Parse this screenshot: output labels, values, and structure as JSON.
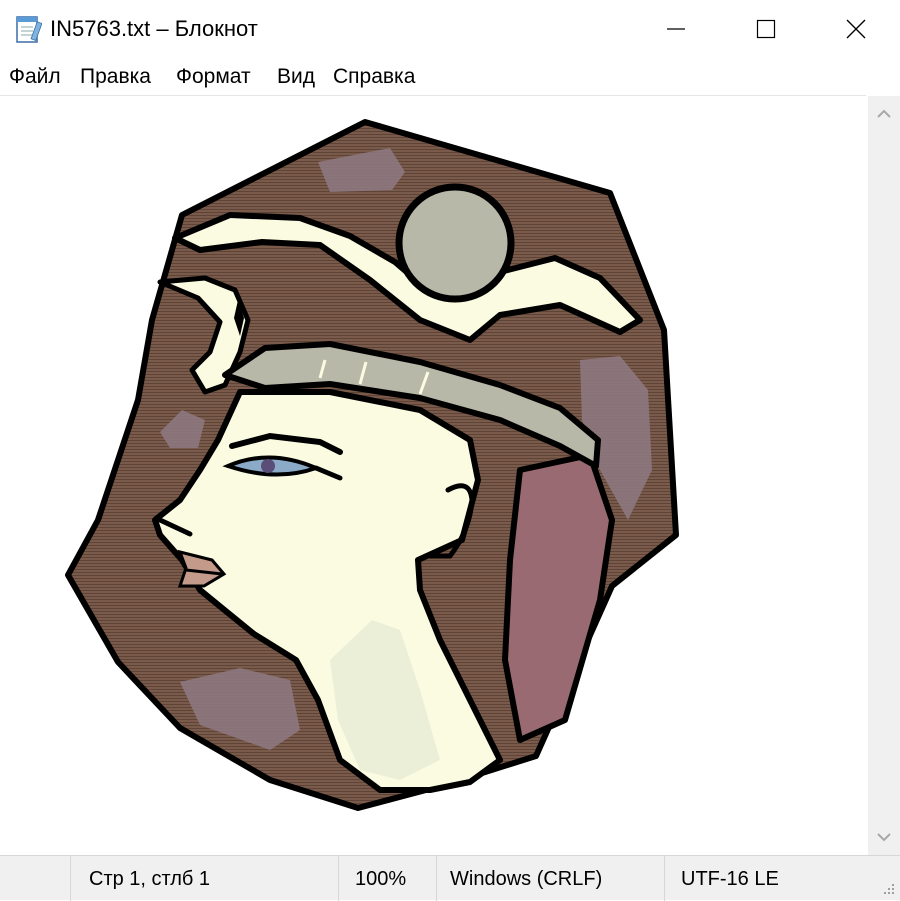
{
  "window": {
    "title": "IN5763.txt – Блокнот"
  },
  "menu": {
    "items": [
      "Файл",
      "Правка",
      "Формат",
      "Вид",
      "Справка"
    ]
  },
  "statusbar": {
    "position": "Стр 1, стлб 1",
    "zoom": "100%",
    "line_endings": "Windows (CRLF)",
    "encoding": "UTF-16 LE"
  },
  "icons": {
    "app": "notepad-icon",
    "minimize": "minimize-icon",
    "maximize": "maximize-icon",
    "close": "close-icon",
    "scroll_up": "chevron-up-icon",
    "scroll_down": "chevron-down-icon",
    "grip": "resize-grip-icon"
  },
  "colors": {
    "hair_brown": "#7a5a4a",
    "skin": "#fbfbe2",
    "outline": "#000000",
    "disc": "#b8b8a8",
    "headscarf_mauve": "#9a6a72",
    "patch_mauve": "#8e7a82",
    "eye_blue": "#8aaac8",
    "lips": "#c49a8a"
  }
}
